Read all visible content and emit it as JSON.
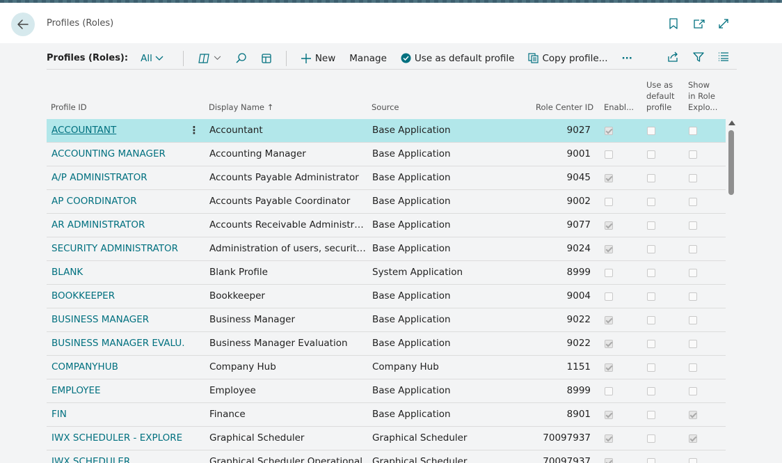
{
  "header": {
    "title": "Profiles (Roles)",
    "icons": [
      "back-arrow-icon",
      "bookmark-icon",
      "open-new-window-icon",
      "expand-icon"
    ]
  },
  "actionbar": {
    "title": "Profiles (Roles):",
    "filter": "All",
    "new_label": "New",
    "manage_label": "Manage",
    "default_label": "Use as default profile",
    "copy_label": "Copy profile...",
    "more_label": "···"
  },
  "columns": {
    "profile_id": "Profile ID",
    "display_name": "Display Name",
    "sort_indicator": "↑",
    "source": "Source",
    "role_center": "Role Center ID",
    "enabled": "Enabl...",
    "default_1": "Use as",
    "default_2": "default",
    "default_3": "profile",
    "show_1": "Show",
    "show_2": "in Role",
    "show_3": "Explo..."
  },
  "rows": [
    {
      "id": "ACCOUNTANT",
      "name": "Accountant",
      "source": "Base Application",
      "rc": "9027",
      "enabled": true,
      "default": false,
      "show": false,
      "selected": true
    },
    {
      "id": "ACCOUNTING MANAGER",
      "name": "Accounting Manager",
      "source": "Base Application",
      "rc": "9001",
      "enabled": false,
      "default": false,
      "show": false
    },
    {
      "id": "A/P ADMINISTRATOR",
      "name": "Accounts Payable Administrator",
      "source": "Base Application",
      "rc": "9045",
      "enabled": true,
      "default": false,
      "show": false
    },
    {
      "id": "AP COORDINATOR",
      "name": "Accounts Payable Coordinator",
      "source": "Base Application",
      "rc": "9002",
      "enabled": false,
      "default": false,
      "show": false
    },
    {
      "id": "AR ADMINISTRATOR",
      "name": "Accounts Receivable Administrator",
      "source": "Base Application",
      "rc": "9077",
      "enabled": true,
      "default": false,
      "show": false
    },
    {
      "id": "SECURITY ADMINISTRATOR",
      "name": "Administration of users, security gr...",
      "source": "Base Application",
      "rc": "9024",
      "enabled": true,
      "default": false,
      "show": false
    },
    {
      "id": "BLANK",
      "name": "Blank Profile",
      "source": "System Application",
      "rc": "8999",
      "enabled": false,
      "default": false,
      "show": false
    },
    {
      "id": "BOOKKEEPER",
      "name": "Bookkeeper",
      "source": "Base Application",
      "rc": "9004",
      "enabled": false,
      "default": false,
      "show": false
    },
    {
      "id": "BUSINESS MANAGER",
      "name": "Business Manager",
      "source": "Base Application",
      "rc": "9022",
      "enabled": true,
      "default": false,
      "show": false
    },
    {
      "id": "BUSINESS MANAGER EVALU...",
      "name": "Business Manager Evaluation",
      "source": "Base Application",
      "rc": "9022",
      "enabled": true,
      "default": false,
      "show": false
    },
    {
      "id": "COMPANYHUB",
      "name": "Company Hub",
      "source": "Company Hub",
      "rc": "1151",
      "enabled": true,
      "default": false,
      "show": false
    },
    {
      "id": "EMPLOYEE",
      "name": "Employee",
      "source": "Base Application",
      "rc": "8999",
      "enabled": false,
      "default": false,
      "show": false
    },
    {
      "id": "FIN",
      "name": "Finance",
      "source": "Base Application",
      "rc": "8901",
      "enabled": true,
      "default": false,
      "show": true
    },
    {
      "id": "IWX SCHEDULER - EXPLORE ...",
      "name": "Graphical Scheduler",
      "source": "Graphical Scheduler",
      "rc": "70097937",
      "enabled": true,
      "default": false,
      "show": true
    },
    {
      "id": "IWX SCHEDULER",
      "name": "Graphical Scheduler Operational",
      "source": "Graphical Scheduler",
      "rc": "70097937",
      "enabled": true,
      "default": false,
      "show": false
    }
  ]
}
